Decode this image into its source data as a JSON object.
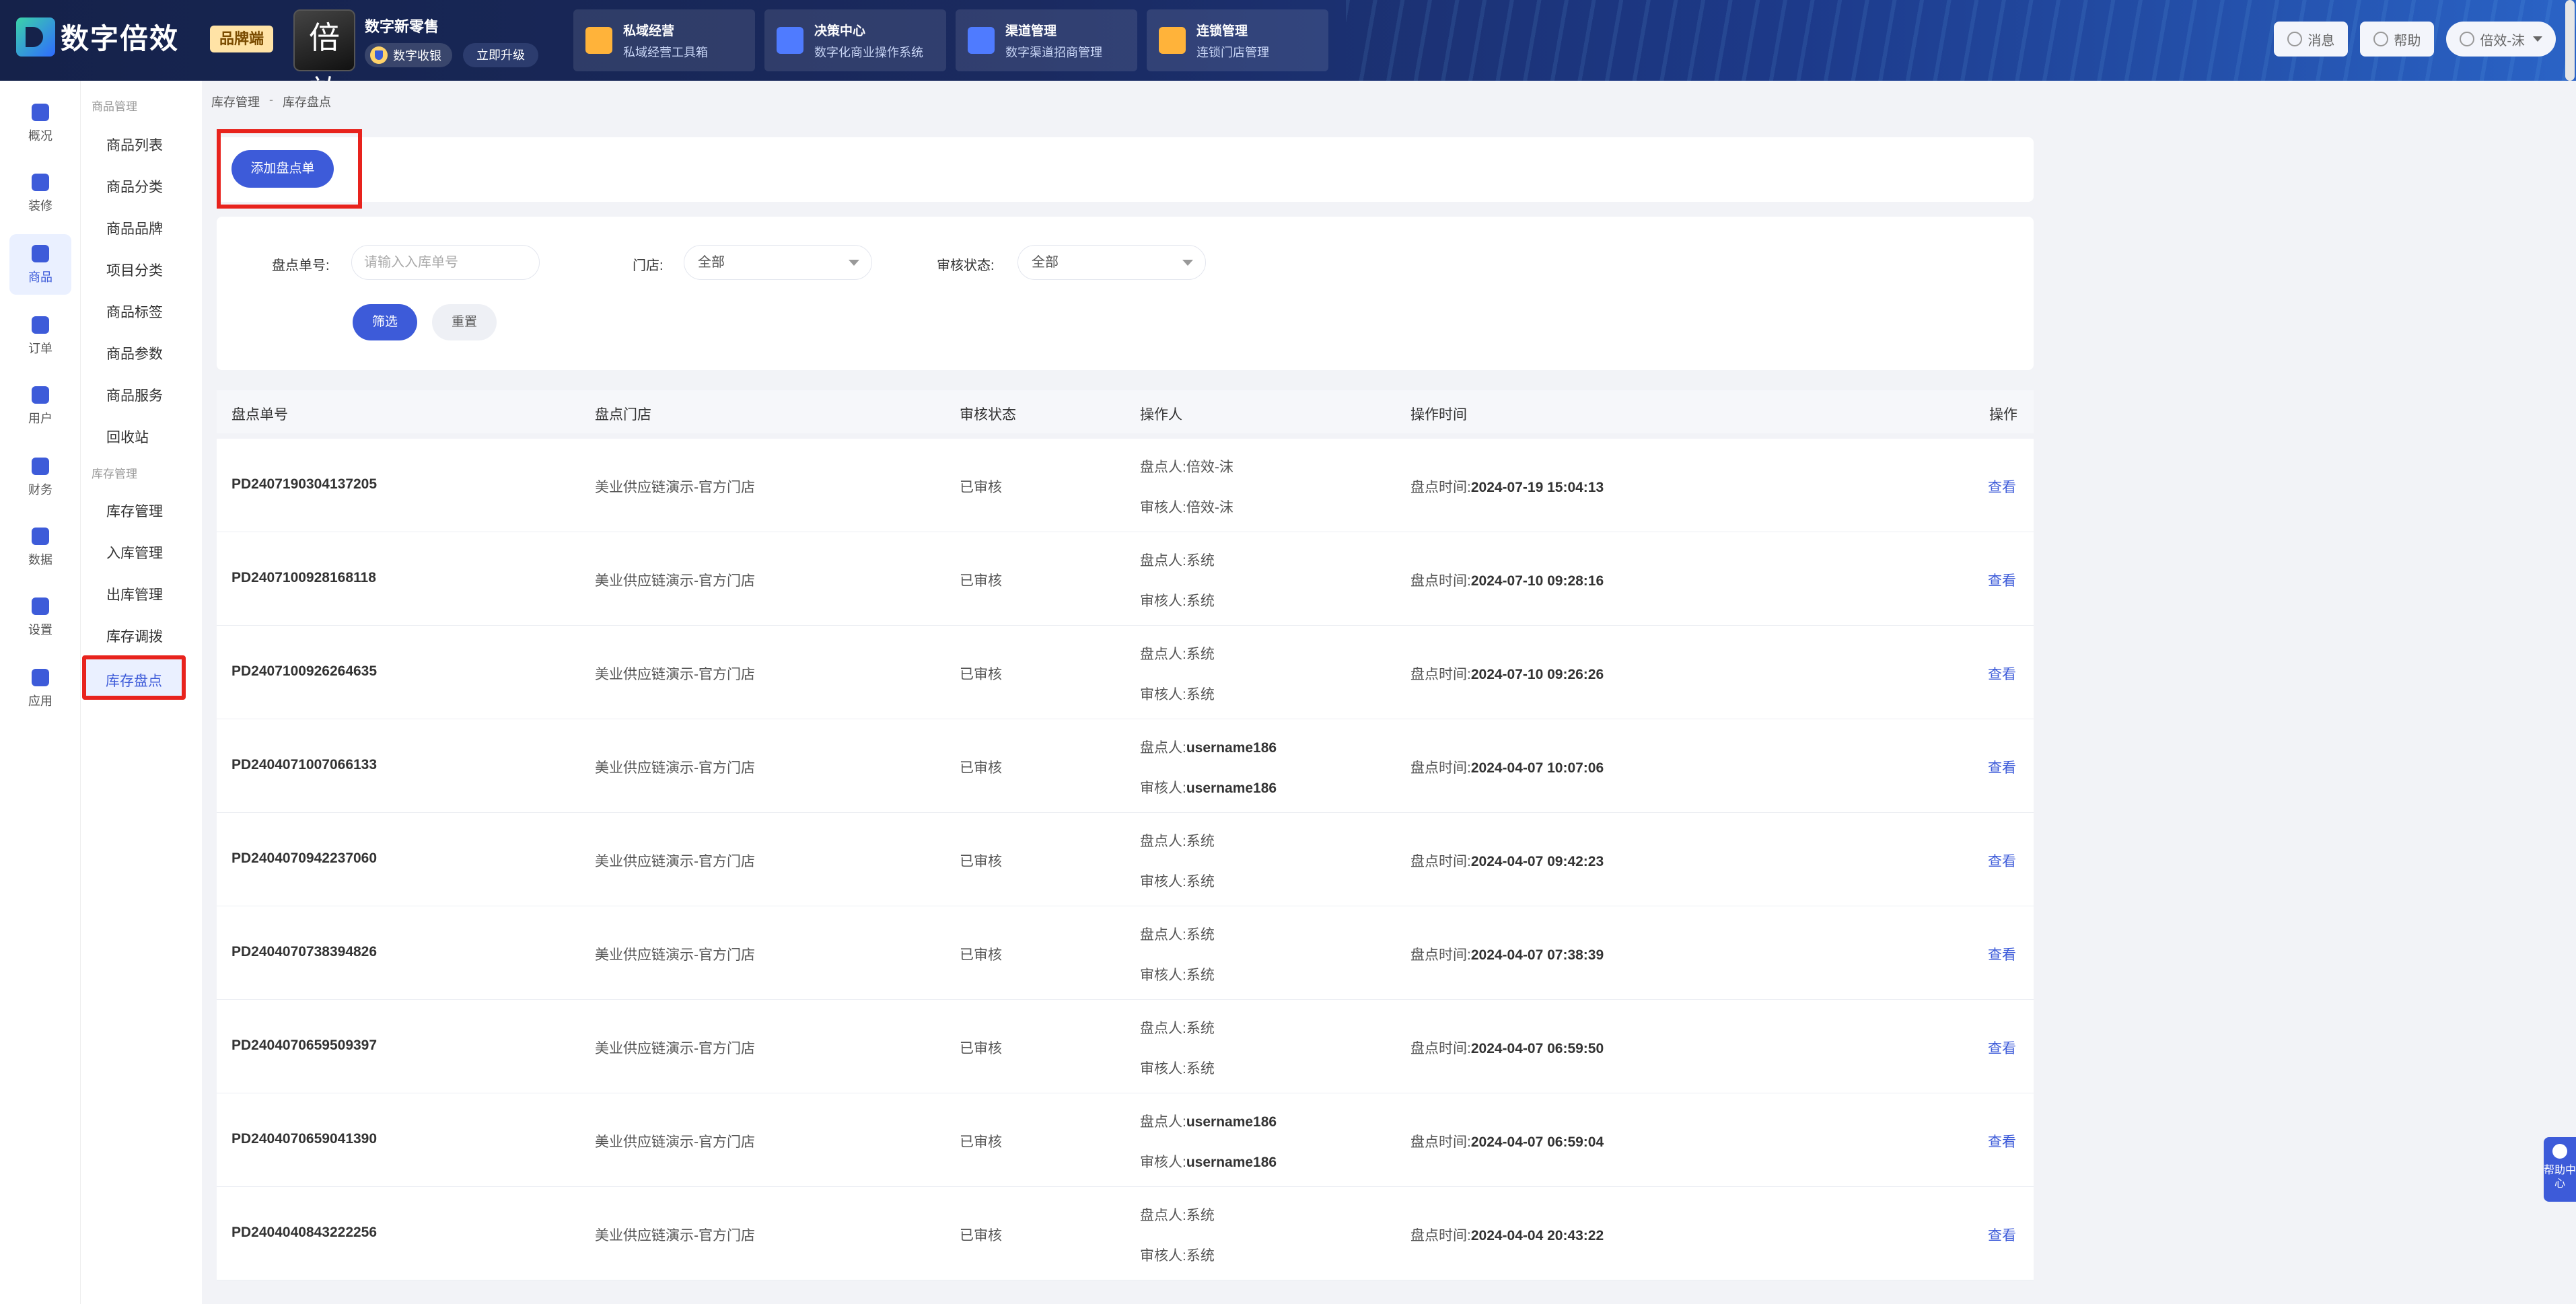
{
  "header": {
    "logo_text": "数字倍效",
    "brand_tag": "品牌端",
    "store_badge": "倍效",
    "retail_name": "数字新零售",
    "pay_label": "数字收银",
    "upgrade_label": "立即升级",
    "modules": [
      {
        "title": "私域经营",
        "subtitle": "私域经营工具箱",
        "icon": "grid-icon",
        "color": "#ffb33a"
      },
      {
        "title": "决策中心",
        "subtitle": "数字化商业操作系统",
        "icon": "chart-icon",
        "color": "#4f7bff"
      },
      {
        "title": "渠道管理",
        "subtitle": "数字渠道招商管理",
        "icon": "trend-icon",
        "color": "#4f7bff"
      },
      {
        "title": "连锁管理",
        "subtitle": "连锁门店管理",
        "icon": "store-icon",
        "color": "#ffb33a"
      }
    ],
    "message_label": "消息",
    "help_label": "帮助",
    "user_label": "倍效-沫"
  },
  "rail": [
    {
      "label": "概况",
      "icon": "overview-icon"
    },
    {
      "label": "装修",
      "icon": "decorate-icon"
    },
    {
      "label": "商品",
      "icon": "goods-icon",
      "active": true
    },
    {
      "label": "订单",
      "icon": "order-icon"
    },
    {
      "label": "用户",
      "icon": "user-icon"
    },
    {
      "label": "财务",
      "icon": "finance-icon"
    },
    {
      "label": "数据",
      "icon": "data-icon"
    },
    {
      "label": "设置",
      "icon": "settings-icon"
    },
    {
      "label": "应用",
      "icon": "apps-icon"
    }
  ],
  "subnav": {
    "group1": "商品管理",
    "items1": [
      "商品列表",
      "商品分类",
      "商品品牌",
      "项目分类",
      "商品标签",
      "商品参数",
      "商品服务",
      "回收站"
    ],
    "group2": "库存管理",
    "items2": [
      "库存管理",
      "入库管理",
      "出库管理",
      "库存调拨",
      "库存盘点"
    ]
  },
  "breadcrumb": {
    "parent": "库存管理",
    "sep": "-",
    "current": "库存盘点"
  },
  "add_button": "添加盘点单",
  "filter": {
    "order_label": "盘点单号:",
    "order_placeholder": "请输入入库单号",
    "store_label": "门店:",
    "store_value": "全部",
    "status_label": "审核状态:",
    "status_value": "全部",
    "filter_button": "筛选",
    "reset_button": "重置"
  },
  "table": {
    "headers": [
      "盘点单号",
      "盘点门店",
      "审核状态",
      "操作人",
      "操作时间",
      "操作"
    ],
    "counter_prefix": "盘点人:",
    "auditor_prefix": "审核人:",
    "time_prefix": "盘点时间:",
    "view_label": "查看",
    "rows": [
      {
        "id": "PD2407190304137205",
        "store": "美业供应链演示-官方门店",
        "status": "已审核",
        "counter": "倍效-沫",
        "auditor": "倍效-沫",
        "time": "2024-07-19 15:04:13",
        "bold_user": false
      },
      {
        "id": "PD2407100928168118",
        "store": "美业供应链演示-官方门店",
        "status": "已审核",
        "counter": "系统",
        "auditor": "系统",
        "time": "2024-07-10 09:28:16",
        "bold_user": false
      },
      {
        "id": "PD2407100926264635",
        "store": "美业供应链演示-官方门店",
        "status": "已审核",
        "counter": "系统",
        "auditor": "系统",
        "time": "2024-07-10 09:26:26",
        "bold_user": false
      },
      {
        "id": "PD2404071007066133",
        "store": "美业供应链演示-官方门店",
        "status": "已审核",
        "counter": "username186",
        "auditor": "username186",
        "time": "2024-04-07 10:07:06",
        "bold_user": true
      },
      {
        "id": "PD2404070942237060",
        "store": "美业供应链演示-官方门店",
        "status": "已审核",
        "counter": "系统",
        "auditor": "系统",
        "time": "2024-04-07 09:42:23",
        "bold_user": false
      },
      {
        "id": "PD2404070738394826",
        "store": "美业供应链演示-官方门店",
        "status": "已审核",
        "counter": "系统",
        "auditor": "系统",
        "time": "2024-04-07 07:38:39",
        "bold_user": false
      },
      {
        "id": "PD2404070659509397",
        "store": "美业供应链演示-官方门店",
        "status": "已审核",
        "counter": "系统",
        "auditor": "系统",
        "time": "2024-04-07 06:59:50",
        "bold_user": false
      },
      {
        "id": "PD2404070659041390",
        "store": "美业供应链演示-官方门店",
        "status": "已审核",
        "counter": "username186",
        "auditor": "username186",
        "time": "2024-04-07 06:59:04",
        "bold_user": true
      },
      {
        "id": "PD2404040843222256",
        "store": "美业供应链演示-官方门店",
        "status": "已审核",
        "counter": "系统",
        "auditor": "系统",
        "time": "2024-04-04 20:43:22",
        "bold_user": false
      }
    ]
  },
  "help_center": "帮助中心"
}
